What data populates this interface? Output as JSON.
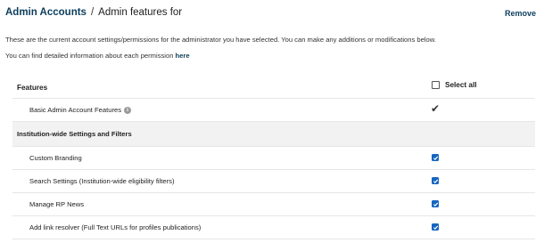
{
  "breadcrumb": {
    "parent": "Admin Accounts",
    "separator": "/",
    "current": "Admin features for"
  },
  "actions": {
    "remove": "Remove"
  },
  "intro": {
    "line1": "These are the current account settings/permissions for the administrator you have selected. You can make any additions or modifications below.",
    "line2_prefix": "You can find detailed information about each permission",
    "line2_link": "here"
  },
  "table": {
    "header_label": "Features",
    "select_all_label": "Select all",
    "select_all_checked": false,
    "rows": [
      {
        "label": "Basic Admin Account Features",
        "type": "fixed",
        "has_info": true,
        "mark": "✔"
      },
      {
        "label": "Institution-wide Settings and Filters",
        "type": "section"
      },
      {
        "label": "Custom Branding",
        "type": "checkbox",
        "checked": true
      },
      {
        "label": "Search Settings (Institution-wide eligibility filters)",
        "type": "checkbox",
        "checked": true
      },
      {
        "label": "Manage RP News",
        "type": "checkbox",
        "checked": true
      },
      {
        "label": "Add link resolver (Full Text URLs for profiles publications)",
        "type": "checkbox",
        "checked": true
      }
    ]
  },
  "colors": {
    "link": "#0b3d5c",
    "checkbox_fill": "#1565c0",
    "section_bg": "#f2f2f2"
  }
}
